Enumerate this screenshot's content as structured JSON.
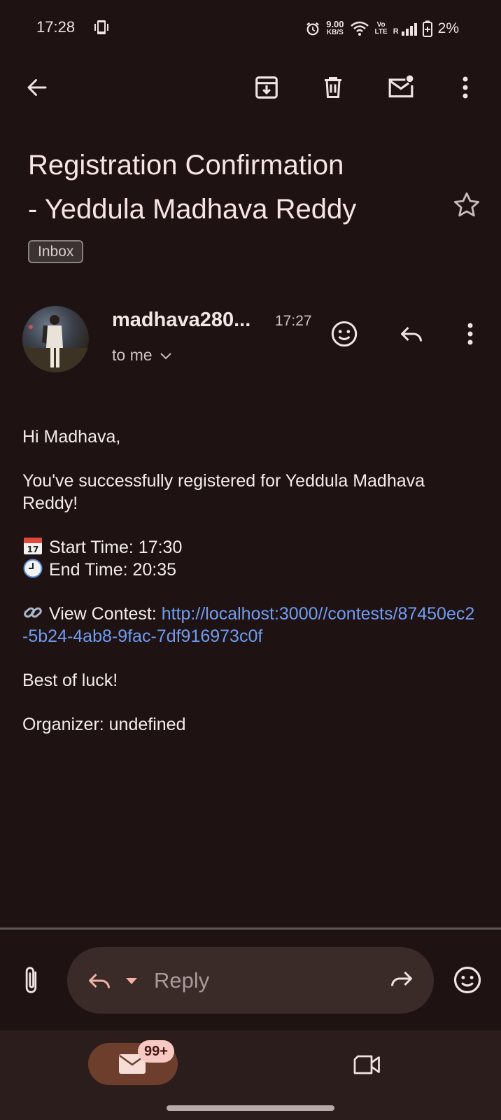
{
  "status_bar": {
    "time": "17:28",
    "net_speed_value": "9.00",
    "net_speed_unit": "KB/S",
    "volte_top": "Vo",
    "volte_bottom": "LTE",
    "roaming": "R",
    "battery": "2%"
  },
  "toolbar": {
    "back_icon": "arrow-left-icon",
    "archive_icon": "archive-icon",
    "delete_icon": "trash-icon",
    "mark_unread_icon": "mark-unread-icon",
    "more_icon": "more-vert-icon"
  },
  "email": {
    "subject_line1": "Registration Confirmation",
    "subject_line2": "- Yeddula Madhava Reddy",
    "label": "Inbox",
    "sender": "madhava280...",
    "time": "17:27",
    "recipient": "to me",
    "body": {
      "greeting": "Hi Madhava,",
      "intro": "You've successfully registered for Yeddula Madhava Reddy!",
      "start_label": "Start Time: 17:30",
      "end_label": "End Time: 20:35",
      "view_label": "View Contest: ",
      "contest_link": "http://localhost:3000//contests/87450ec2-5b24-4ab8-9fac-7df916973c0f",
      "closing": "Best of luck!",
      "organizer": "Organizer: undefined"
    }
  },
  "reply_bar": {
    "placeholder": "Reply"
  },
  "nav": {
    "mail_badge": "99+"
  },
  "colors": {
    "background": "#1e1212",
    "link": "#6f9cf2",
    "accent_pill": "#6e3e2c",
    "badge": "#f7c9c5"
  }
}
